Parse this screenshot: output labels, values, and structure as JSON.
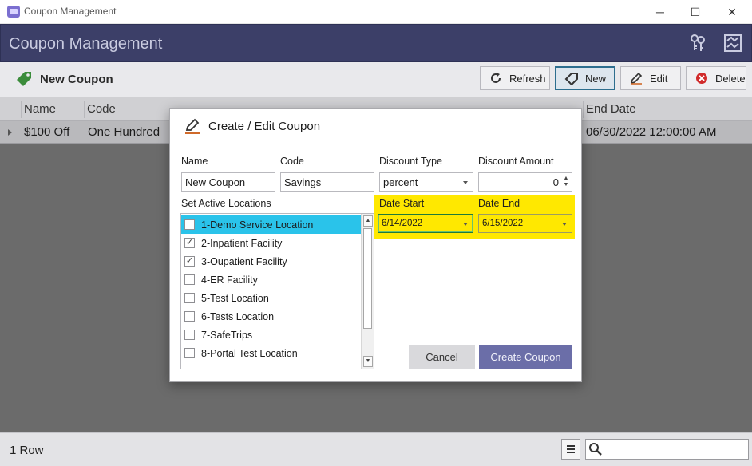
{
  "window": {
    "title": "Coupon Management",
    "minimize": "─",
    "maximize": "☐",
    "close": "✕"
  },
  "header": {
    "title": "Coupon Management",
    "icons": [
      "keys-icon",
      "report-icon"
    ]
  },
  "toolbar": {
    "page_title": "New Coupon",
    "refresh_label": "Refresh",
    "new_label": "New",
    "edit_label": "Edit",
    "delete_label": "Delete"
  },
  "grid": {
    "columns": [
      "Name",
      "Code",
      "End Date"
    ],
    "rows": [
      {
        "name": "$100 Off",
        "code": "One Hundred",
        "end_date": "06/30/2022 12:00:00 AM"
      }
    ]
  },
  "status": {
    "row_count": "1 Row"
  },
  "dialog": {
    "title": "Create / Edit Coupon",
    "name_label": "Name",
    "name_value": "New Coupon",
    "code_label": "Code",
    "code_value": "Savings",
    "discount_type_label": "Discount Type",
    "discount_type_value": "percent",
    "discount_amount_label": "Discount Amount",
    "discount_amount_value": "0",
    "locations_label": "Set Active Locations",
    "date_start_label": "Date Start",
    "date_start_value": "6/14/2022",
    "date_end_label": "Date End",
    "date_end_value": "6/15/2022",
    "highlight_color": "#ffe800",
    "locations": [
      {
        "label": "1-Demo Service Location",
        "checked": false,
        "selected": true
      },
      {
        "label": "2-Inpatient Facility",
        "checked": true,
        "selected": false
      },
      {
        "label": "3-Oupatient Facility",
        "checked": true,
        "selected": false
      },
      {
        "label": "4-ER Facility",
        "checked": false,
        "selected": false
      },
      {
        "label": "5-Test Location",
        "checked": false,
        "selected": false
      },
      {
        "label": "6-Tests Location",
        "checked": false,
        "selected": false
      },
      {
        "label": "7-SafeTrips",
        "checked": false,
        "selected": false
      },
      {
        "label": "8-Portal Test Location",
        "checked": false,
        "selected": false
      }
    ],
    "cancel_label": "Cancel",
    "create_label": "Create Coupon"
  }
}
